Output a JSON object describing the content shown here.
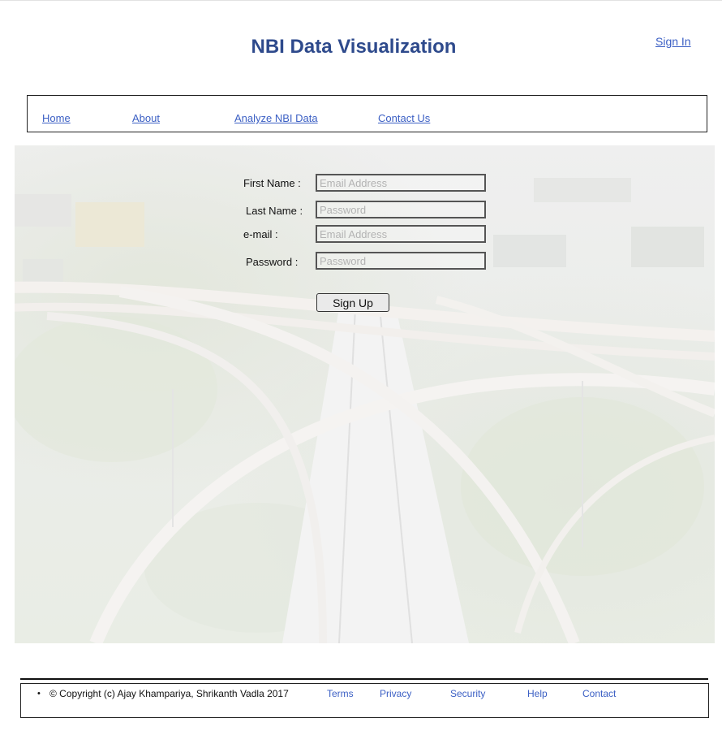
{
  "header": {
    "title": "NBI Data Visualization",
    "sign_in": "Sign In"
  },
  "nav": {
    "items": [
      {
        "label": "Home"
      },
      {
        "label": "About"
      },
      {
        "label": "Analyze NBI Data"
      },
      {
        "label": "Contact Us"
      }
    ]
  },
  "form": {
    "first_name": {
      "label": "First Name :",
      "placeholder": "Email Address"
    },
    "last_name": {
      "label": "Last Name :",
      "placeholder": "Password"
    },
    "email": {
      "label": "e-mail :",
      "placeholder": "Email Address"
    },
    "password": {
      "label": "Password :",
      "placeholder": "Password"
    },
    "submit_label": "Sign Up"
  },
  "footer": {
    "bullet": "•",
    "copyright": "©   Copyright (c) Ajay Khampariya, Shrikanth Vadla 2017",
    "links": [
      {
        "label": "Terms"
      },
      {
        "label": "Privacy"
      },
      {
        "label": "Security"
      },
      {
        "label": "Help"
      },
      {
        "label": "Contact"
      }
    ]
  },
  "colors": {
    "title": "#2e4a8c",
    "link": "#3b5fc4"
  }
}
